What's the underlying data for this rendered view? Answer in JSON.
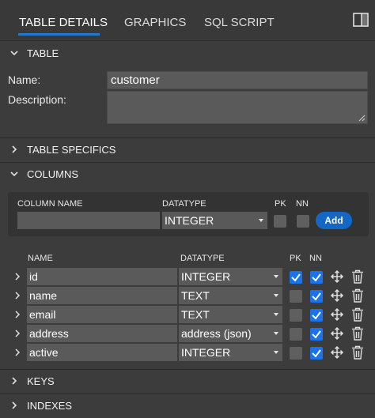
{
  "tabs": [
    {
      "label": "TABLE DETAILS",
      "active": true
    },
    {
      "label": "GRAPHICS",
      "active": false
    },
    {
      "label": "SQL SCRIPT",
      "active": false
    }
  ],
  "sections": {
    "table": "TABLE",
    "table_specifics": "TABLE SPECIFICS",
    "columns": "COLUMNS",
    "keys": "KEYS",
    "indexes": "INDEXES"
  },
  "table": {
    "name_label": "Name:",
    "name_value": "customer",
    "description_label": "Description:",
    "description_value": ""
  },
  "new_column": {
    "headers": {
      "name": "COLUMN NAME",
      "datatype": "DATATYPE",
      "pk": "PK",
      "nn": "NN"
    },
    "name_value": "",
    "datatype_value": "INTEGER",
    "pk": false,
    "nn": false,
    "add_label": "Add"
  },
  "columns_table": {
    "headers": {
      "name": "NAME",
      "datatype": "DATATYPE",
      "pk": "PK",
      "nn": "NN"
    },
    "rows": [
      {
        "name": "id",
        "datatype": "INTEGER",
        "pk": true,
        "nn": true
      },
      {
        "name": "name",
        "datatype": "TEXT",
        "pk": false,
        "nn": true
      },
      {
        "name": "email",
        "datatype": "TEXT",
        "pk": false,
        "nn": true
      },
      {
        "name": "address",
        "datatype": "address (json)",
        "pk": false,
        "nn": true
      },
      {
        "name": "active",
        "datatype": "INTEGER",
        "pk": false,
        "nn": true
      }
    ]
  },
  "colors": {
    "accent": "#1e7bd0",
    "checkbox_on": "#1a73e8",
    "add_button": "#1467c4"
  }
}
